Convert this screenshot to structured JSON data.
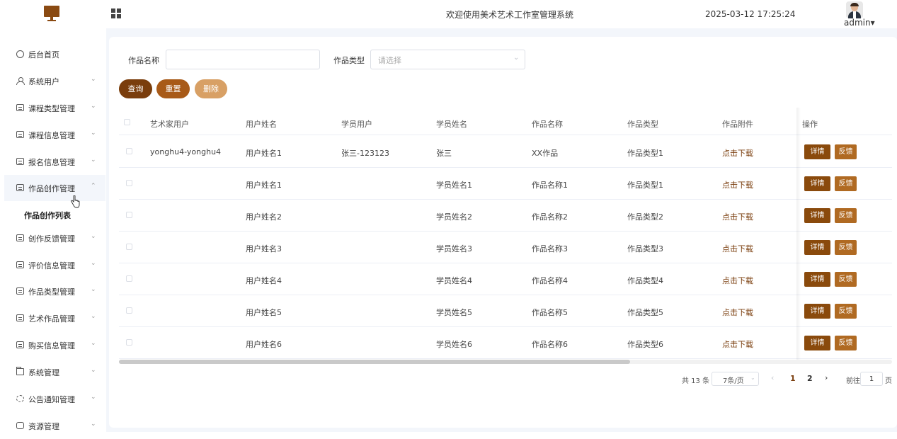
{
  "header": {
    "title": "欢迎使用美术艺术工作室管理系统",
    "datetime": "2025-03-12 17:25:24",
    "username": "admin",
    "dropdown_caret": "▾"
  },
  "sidebar": {
    "items": [
      {
        "label": "后台首页",
        "icon": "clock-icon",
        "arrow": ""
      },
      {
        "label": "系统用户",
        "icon": "user-icon",
        "arrow": "⌄"
      },
      {
        "label": "课程类型管理",
        "icon": "form-icon",
        "arrow": "⌄"
      },
      {
        "label": "课程信息管理",
        "icon": "form-icon",
        "arrow": "⌄"
      },
      {
        "label": "报名信息管理",
        "icon": "form-icon",
        "arrow": "⌄"
      },
      {
        "label": "作品创作管理",
        "icon": "form-icon",
        "arrow": "⌃"
      },
      {
        "label": "创作反馈管理",
        "icon": "form-icon",
        "arrow": "⌄"
      },
      {
        "label": "评价信息管理",
        "icon": "form-icon",
        "arrow": "⌄"
      },
      {
        "label": "作品类型管理",
        "icon": "form-icon",
        "arrow": "⌄"
      },
      {
        "label": "艺术作品管理",
        "icon": "form-icon",
        "arrow": "⌄"
      },
      {
        "label": "购买信息管理",
        "icon": "form-icon",
        "arrow": "⌄"
      },
      {
        "label": "系统管理",
        "icon": "folder-icon",
        "arrow": "⌄"
      },
      {
        "label": "公告通知管理",
        "icon": "sun-icon",
        "arrow": "⌄"
      },
      {
        "label": "资源管理",
        "icon": "bag-icon",
        "arrow": "⌄"
      }
    ],
    "submenu": {
      "label": "作品创作列表"
    }
  },
  "filters": {
    "name_label": "作品名称",
    "name_value": "",
    "type_label": "作品类型",
    "type_placeholder": "请选择",
    "select_arrow": "⌄"
  },
  "buttons": {
    "query": "查询",
    "reset": "重置",
    "delete": "删除"
  },
  "table": {
    "columns": [
      "艺术家用户",
      "用户姓名",
      "学员用户",
      "学员姓名",
      "作品名称",
      "作品类型",
      "作品附件",
      "操作"
    ],
    "rows": [
      {
        "artist": "yonghu4-yonghu4",
        "user_name": "用户姓名1",
        "student": "张三-123123",
        "student_name": "张三",
        "work_name": "XX作品",
        "work_type": "作品类型1",
        "attachment": "点击下载"
      },
      {
        "artist": "",
        "user_name": "用户姓名1",
        "student": "",
        "student_name": "学员姓名1",
        "work_name": "作品名称1",
        "work_type": "作品类型1",
        "attachment": "点击下载"
      },
      {
        "artist": "",
        "user_name": "用户姓名2",
        "student": "",
        "student_name": "学员姓名2",
        "work_name": "作品名称2",
        "work_type": "作品类型2",
        "attachment": "点击下载"
      },
      {
        "artist": "",
        "user_name": "用户姓名3",
        "student": "",
        "student_name": "学员姓名3",
        "work_name": "作品名称3",
        "work_type": "作品类型3",
        "attachment": "点击下载"
      },
      {
        "artist": "",
        "user_name": "用户姓名4",
        "student": "",
        "student_name": "学员姓名4",
        "work_name": "作品名称4",
        "work_type": "作品类型4",
        "attachment": "点击下载"
      },
      {
        "artist": "",
        "user_name": "用户姓名5",
        "student": "",
        "student_name": "学员姓名5",
        "work_name": "作品名称5",
        "work_type": "作品类型5",
        "attachment": "点击下载"
      },
      {
        "artist": "",
        "user_name": "用户姓名6",
        "student": "",
        "student_name": "学员姓名6",
        "work_name": "作品名称6",
        "work_type": "作品类型6",
        "attachment": "点击下载"
      }
    ],
    "detail_label": "详情",
    "feedback_label": "反馈"
  },
  "pagination": {
    "total": "共 13 条",
    "page_size": "7条/页",
    "size_arrow": "⌄",
    "prev": "‹",
    "next": "›",
    "pages": [
      "1",
      "2"
    ],
    "current_page": "1",
    "goto_label": "前往",
    "goto_value": "1",
    "page_suffix": "页"
  },
  "colors": {
    "accent": "#7a3d0c",
    "accent_mid": "#a85a18",
    "accent_light": "#d8a065",
    "background": "#f3f6fb"
  }
}
